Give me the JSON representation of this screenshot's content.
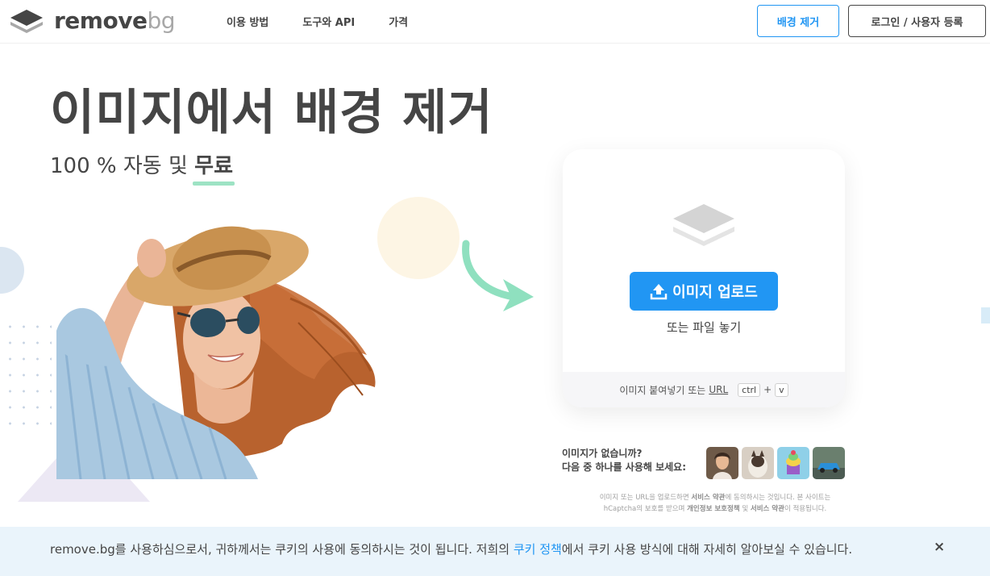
{
  "header": {
    "logo_text_main": "remove",
    "logo_text_suffix": "bg",
    "nav": [
      {
        "label": "이용 방법"
      },
      {
        "label": "도구와 API"
      },
      {
        "label": "가격"
      }
    ],
    "remove_bg_button": "배경 제거",
    "login_button": "로그인 / 사용자 등록"
  },
  "hero": {
    "title": "이미지에서 배경 제거",
    "subtitle_prefix": "100 % 자동 및 ",
    "subtitle_emphasis": "무료"
  },
  "upload_card": {
    "upload_button": "이미지 업로드",
    "drop_text": "또는 파일 놓기",
    "paste_prefix": "이미지 붙여넣기 또는 ",
    "paste_url": "URL",
    "key_ctrl": "ctrl",
    "key_plus": "+",
    "key_v": "v"
  },
  "samples": {
    "line1": "이미지가 없습니까?",
    "line2": "다음 중 하나를 사용해 보세요:"
  },
  "legal": {
    "part1": "이미지 또는 URL을 업로드하면 ",
    "terms1": "서비스 약관",
    "part2": "에 동의하시는 것입니다. 본 사이트는",
    "part3": "hCaptcha의 보호를 받으며 ",
    "privacy": "개인정보 보호정책",
    "part4": " 및 ",
    "terms2": "서비스 약관",
    "part5": "이 적용됩니다."
  },
  "cookie_banner": {
    "text_before": "remove.bg를 사용하심으로서, 귀하께서는 쿠키의 사용에 동의하시는 것이 됩니다. 저희의 ",
    "link": "쿠키 정책",
    "text_after": "에서 쿠키 사용 방식에 대해 자세히 알아보실 수 있습니다.",
    "close": "×"
  },
  "colors": {
    "accent": "#2196f3",
    "text": "#454545",
    "highlight": "#9de3c4",
    "arrow": "#8fe0bf"
  }
}
